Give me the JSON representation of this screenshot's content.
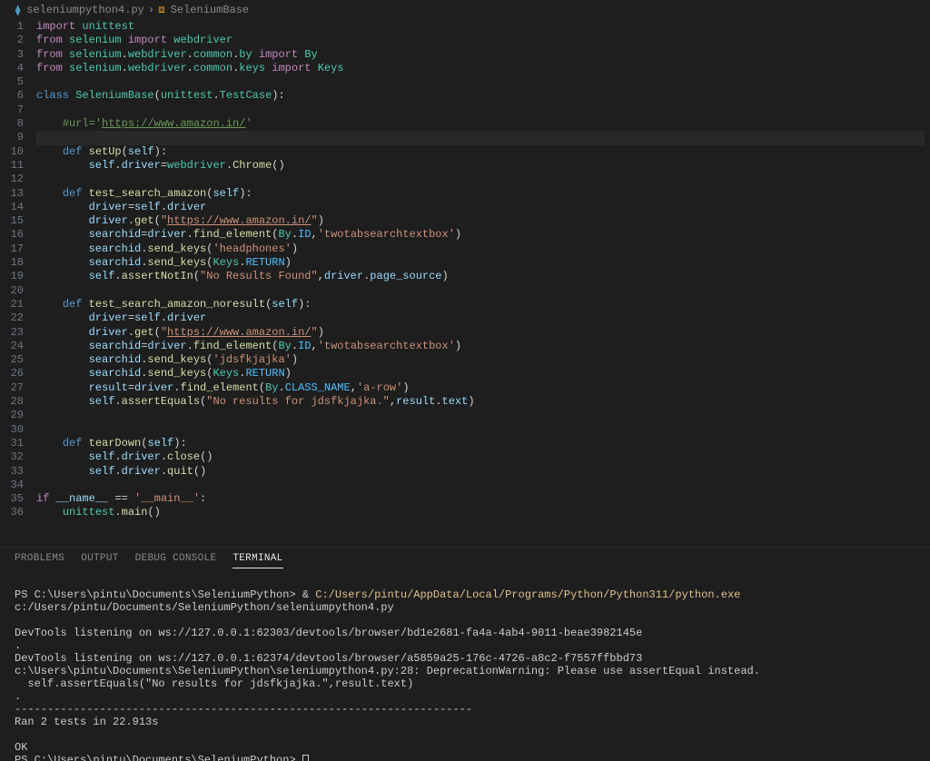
{
  "breadcrumb": {
    "file_icon": "⧈",
    "file": "seleniumpython4.py",
    "sep": "›",
    "class_icon": "⧉",
    "class": "SeleniumBase"
  },
  "lines": [
    {
      "n": 1,
      "html": "<span class='tok-kw2'>import</span> <span class='tok-mod'>unittest</span>"
    },
    {
      "n": 2,
      "html": "<span class='tok-kw2'>from</span> <span class='tok-mod'>selenium</span> <span class='tok-kw2'>import</span> <span class='tok-mod'>webdriver</span>"
    },
    {
      "n": 3,
      "html": "<span class='tok-kw2'>from</span> <span class='tok-mod'>selenium</span><span class='tok-pun'>.</span><span class='tok-mod'>webdriver</span><span class='tok-pun'>.</span><span class='tok-mod'>common</span><span class='tok-pun'>.</span><span class='tok-mod'>by</span> <span class='tok-kw2'>import</span> <span class='tok-mod'>By</span>"
    },
    {
      "n": 4,
      "html": "<span class='tok-kw2'>from</span> <span class='tok-mod'>selenium</span><span class='tok-pun'>.</span><span class='tok-mod'>webdriver</span><span class='tok-pun'>.</span><span class='tok-mod'>common</span><span class='tok-pun'>.</span><span class='tok-mod'>keys</span> <span class='tok-kw2'>import</span> <span class='tok-mod'>Keys</span>"
    },
    {
      "n": 5,
      "html": ""
    },
    {
      "n": 6,
      "html": "<span class='tok-kw'>class</span> <span class='tok-cls'>SeleniumBase</span><span class='tok-pun'>(</span><span class='tok-mod'>unittest</span><span class='tok-pun'>.</span><span class='tok-cls'>TestCase</span><span class='tok-pun'>):</span>"
    },
    {
      "n": 7,
      "html": ""
    },
    {
      "n": 8,
      "html": "    <span class='tok-cmt'>#url='</span><span class='tok-cmt tok-url'>https://www.amazon.in/</span><span class='tok-cmt'>'</span>"
    },
    {
      "n": 9,
      "html": "",
      "hl": true
    },
    {
      "n": 10,
      "html": "    <span class='tok-kw'>def</span> <span class='tok-fn'>setUp</span><span class='tok-pun'>(</span><span class='tok-var'>self</span><span class='tok-pun'>):</span>"
    },
    {
      "n": 11,
      "html": "        <span class='tok-var'>self</span><span class='tok-pun'>.</span><span class='tok-prop'>driver</span><span class='tok-op'>=</span><span class='tok-mod'>webdriver</span><span class='tok-pun'>.</span><span class='tok-fn'>Chrome</span><span class='tok-pun'>()</span>"
    },
    {
      "n": 12,
      "html": ""
    },
    {
      "n": 13,
      "html": "    <span class='tok-kw'>def</span> <span class='tok-fn'>test_search_amazon</span><span class='tok-pun'>(</span><span class='tok-var'>self</span><span class='tok-pun'>):</span>"
    },
    {
      "n": 14,
      "html": "        <span class='tok-prop'>driver</span><span class='tok-op'>=</span><span class='tok-var'>self</span><span class='tok-pun'>.</span><span class='tok-prop'>driver</span>"
    },
    {
      "n": 15,
      "html": "        <span class='tok-prop'>driver</span><span class='tok-pun'>.</span><span class='tok-fn'>get</span><span class='tok-pun'>(</span><span class='tok-str'>\"</span><span class='tok-str tok-url'>https://www.amazon.in/</span><span class='tok-str'>\"</span><span class='tok-pun'>)</span>"
    },
    {
      "n": 16,
      "html": "        <span class='tok-prop'>searchid</span><span class='tok-op'>=</span><span class='tok-prop'>driver</span><span class='tok-pun'>.</span><span class='tok-fn'>find_element</span><span class='tok-pun'>(</span><span class='tok-mod'>By</span><span class='tok-pun'>.</span><span class='tok-const'>ID</span><span class='tok-pun'>,</span><span class='tok-str'>'twotabsearchtextbox'</span><span class='tok-pun'>)</span>"
    },
    {
      "n": 17,
      "html": "        <span class='tok-prop'>searchid</span><span class='tok-pun'>.</span><span class='tok-fn'>send_keys</span><span class='tok-pun'>(</span><span class='tok-str'>'headphones'</span><span class='tok-pun'>)</span>"
    },
    {
      "n": 18,
      "html": "        <span class='tok-prop'>searchid</span><span class='tok-pun'>.</span><span class='tok-fn'>send_keys</span><span class='tok-pun'>(</span><span class='tok-mod'>Keys</span><span class='tok-pun'>.</span><span class='tok-const'>RETURN</span><span class='tok-pun'>)</span>"
    },
    {
      "n": 19,
      "html": "        <span class='tok-var'>self</span><span class='tok-pun'>.</span><span class='tok-fn'>assertNotIn</span><span class='tok-pun'>(</span><span class='tok-str'>\"No Results Found\"</span><span class='tok-pun'>,</span><span class='tok-prop'>driver</span><span class='tok-pun'>.</span><span class='tok-prop'>page_source</span><span class='tok-pun'>)</span>"
    },
    {
      "n": 20,
      "html": ""
    },
    {
      "n": 21,
      "html": "    <span class='tok-kw'>def</span> <span class='tok-fn'>test_search_amazon_noresult</span><span class='tok-pun'>(</span><span class='tok-var'>self</span><span class='tok-pun'>):</span>"
    },
    {
      "n": 22,
      "html": "        <span class='tok-prop'>driver</span><span class='tok-op'>=</span><span class='tok-var'>self</span><span class='tok-pun'>.</span><span class='tok-prop'>driver</span>"
    },
    {
      "n": 23,
      "html": "        <span class='tok-prop'>driver</span><span class='tok-pun'>.</span><span class='tok-fn'>get</span><span class='tok-pun'>(</span><span class='tok-str'>\"</span><span class='tok-str tok-url'>https://www.amazon.in/</span><span class='tok-str'>\"</span><span class='tok-pun'>)</span>"
    },
    {
      "n": 24,
      "html": "        <span class='tok-prop'>searchid</span><span class='tok-op'>=</span><span class='tok-prop'>driver</span><span class='tok-pun'>.</span><span class='tok-fn'>find_element</span><span class='tok-pun'>(</span><span class='tok-mod'>By</span><span class='tok-pun'>.</span><span class='tok-const'>ID</span><span class='tok-pun'>,</span><span class='tok-str'>'twotabsearchtextbox'</span><span class='tok-pun'>)</span>"
    },
    {
      "n": 25,
      "html": "        <span class='tok-prop'>searchid</span><span class='tok-pun'>.</span><span class='tok-fn'>send_keys</span><span class='tok-pun'>(</span><span class='tok-str'>'jdsfkjajka'</span><span class='tok-pun'>)</span>"
    },
    {
      "n": 26,
      "html": "        <span class='tok-prop'>searchid</span><span class='tok-pun'>.</span><span class='tok-fn'>send_keys</span><span class='tok-pun'>(</span><span class='tok-mod'>Keys</span><span class='tok-pun'>.</span><span class='tok-const'>RETURN</span><span class='tok-pun'>)</span>"
    },
    {
      "n": 27,
      "html": "        <span class='tok-prop'>result</span><span class='tok-op'>=</span><span class='tok-prop'>driver</span><span class='tok-pun'>.</span><span class='tok-fn'>find_element</span><span class='tok-pun'>(</span><span class='tok-mod'>By</span><span class='tok-pun'>.</span><span class='tok-const'>CLASS_NAME</span><span class='tok-pun'>,</span><span class='tok-str'>'a-row'</span><span class='tok-pun'>)</span>"
    },
    {
      "n": 28,
      "html": "        <span class='tok-var'>self</span><span class='tok-pun'>.</span><span class='tok-fn'>assertEquals</span><span class='tok-pun'>(</span><span class='tok-str'>\"No results for jdsfkjajka.\"</span><span class='tok-pun'>,</span><span class='tok-prop'>result</span><span class='tok-pun'>.</span><span class='tok-prop'>text</span><span class='tok-pun'>)</span>"
    },
    {
      "n": 29,
      "html": ""
    },
    {
      "n": 30,
      "html": ""
    },
    {
      "n": 31,
      "html": "    <span class='tok-kw'>def</span> <span class='tok-fn'>tearDown</span><span class='tok-pun'>(</span><span class='tok-var'>self</span><span class='tok-pun'>):</span>"
    },
    {
      "n": 32,
      "html": "        <span class='tok-var'>self</span><span class='tok-pun'>.</span><span class='tok-prop'>driver</span><span class='tok-pun'>.</span><span class='tok-fn'>close</span><span class='tok-pun'>()</span>"
    },
    {
      "n": 33,
      "html": "        <span class='tok-var'>self</span><span class='tok-pun'>.</span><span class='tok-prop'>driver</span><span class='tok-pun'>.</span><span class='tok-fn'>quit</span><span class='tok-pun'>()</span>"
    },
    {
      "n": 34,
      "html": ""
    },
    {
      "n": 35,
      "html": "<span class='tok-kw2'>if</span> <span class='tok-var'>__name__</span> <span class='tok-op'>==</span> <span class='tok-str'>'__main__'</span><span class='tok-pun'>:</span>"
    },
    {
      "n": 36,
      "html": "    <span class='tok-mod'>unittest</span><span class='tok-pun'>.</span><span class='tok-fn'>main</span><span class='tok-pun'>()</span>"
    }
  ],
  "panel": {
    "tabs": [
      "PROBLEMS",
      "OUTPUT",
      "DEBUG CONSOLE",
      "TERMINAL"
    ],
    "active": 3
  },
  "terminal": {
    "l1_prompt": "PS C:\\Users\\pintu\\Documents\\SeleniumPython> ",
    "l1_amp": "& ",
    "l1_cmd": "C:/Users/pintu/AppData/Local/Programs/Python/Python311/python.exe",
    "l1_arg": " c:/Users/pintu/Documents/SeleniumPython/seleniumpython4.py",
    "l2": "",
    "l3": "DevTools listening on ws://127.0.0.1:62303/devtools/browser/bd1e2681-fa4a-4ab4-9011-beae3982145e",
    "l4": ".",
    "l5": "DevTools listening on ws://127.0.0.1:62374/devtools/browser/a5859a25-176c-4726-a8c2-f7557ffbbd73",
    "l6": "c:\\Users\\pintu\\Documents\\SeleniumPython\\seleniumpython4.py:28: DeprecationWarning: Please use assertEqual instead.",
    "l7": "  self.assertEquals(\"No results for jdsfkjajka.\",result.text)",
    "l8": ".",
    "l9": "----------------------------------------------------------------------",
    "l10": "Ran 2 tests in 22.913s",
    "l11": "",
    "l12": "OK",
    "l13_prompt": "PS C:\\Users\\pintu\\Documents\\SeleniumPython> "
  }
}
